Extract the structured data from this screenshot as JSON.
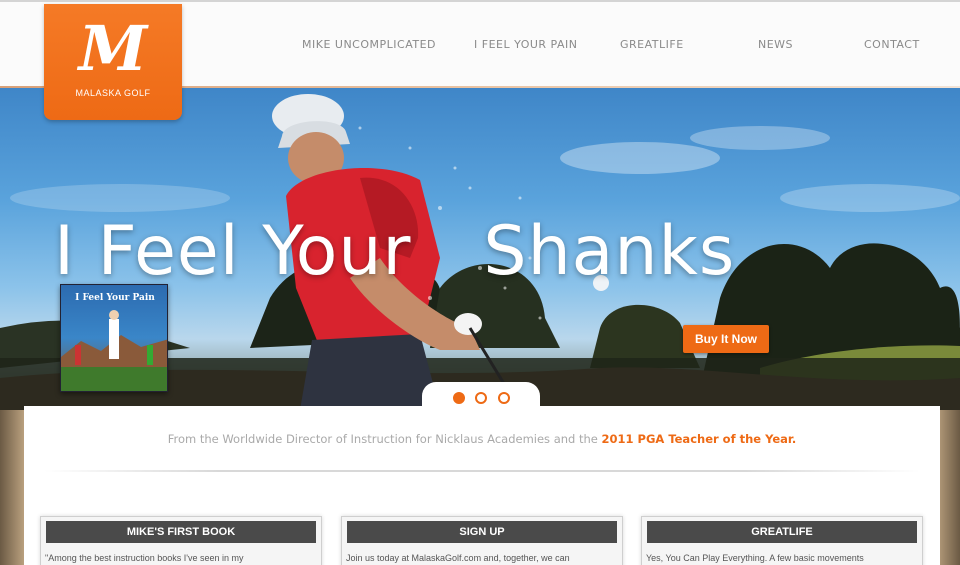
{
  "logo": {
    "letter": "M",
    "subtitle": "MALASKA GOLF"
  },
  "nav": {
    "items": [
      {
        "label": "MIKE UNCOMPLICATED"
      },
      {
        "label": "I FEEL YOUR PAIN"
      },
      {
        "label": "GREATLIFE"
      },
      {
        "label": "NEWS"
      },
      {
        "label": "CONTACT"
      }
    ]
  },
  "hero": {
    "title_left": "I Feel Your",
    "title_right": "Shanks",
    "book_title": "I Feel Your Pain",
    "cta_label": "Buy It Now",
    "slides": {
      "count": 3,
      "active": 1
    }
  },
  "tagline": {
    "text": "From the Worldwide Director of Instruction for Nicklaus Academies and the",
    "highlight": "2011 PGA Teacher of the Year."
  },
  "panels": [
    {
      "title": "MIKE'S FIRST BOOK",
      "text": "\"Among the best instruction books I've seen in my"
    },
    {
      "title": "SIGN UP",
      "text": "Join us today at MalaskaGolf.com and, together, we can"
    },
    {
      "title": "GREATLIFE",
      "text": "Yes, You Can Play Everything. A few basic movements"
    }
  ],
  "colors": {
    "accent": "#ee6a15",
    "panel_header": "#4a4a4a",
    "nav_text": "#8a8a8a"
  }
}
